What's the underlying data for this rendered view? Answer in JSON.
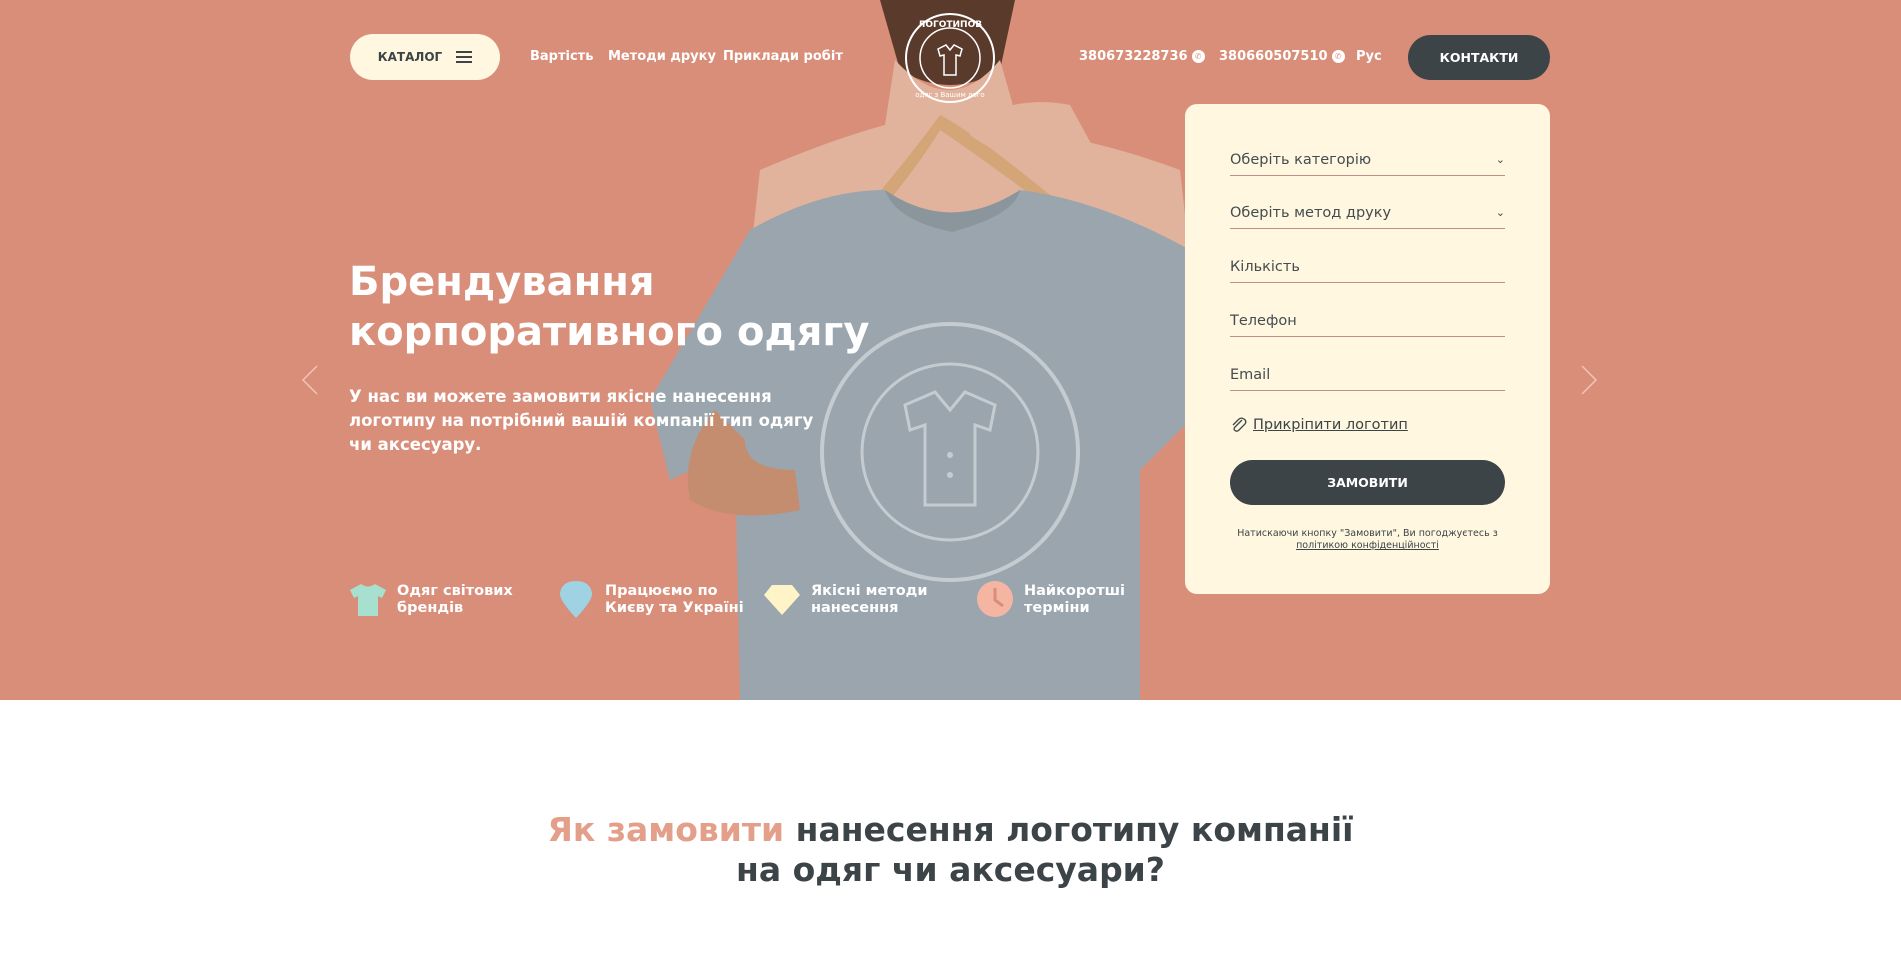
{
  "colors": {
    "hero_bg": "#d98e7a",
    "dark": "#3c4448",
    "cream": "#fff7df",
    "accent": "#e39f89"
  },
  "header": {
    "catalog_label": "КАТАЛОГ",
    "nav": [
      "Вартість",
      "Методи друку",
      "Приклади робіт"
    ],
    "phones": [
      "380673228736",
      "380660507510"
    ],
    "lang": "Рус",
    "contacts_label": "КОНТАКТИ",
    "logo": {
      "top_text": "ЛОГОТИПОВ",
      "bottom_text": "одяг з Вашим лого"
    }
  },
  "hero": {
    "title_line1": "Брендування",
    "title_line2": "корпоративного одягу",
    "subtitle": "У нас ви можете замовити якісне нанесення логотипу на потрібний вашій компанії тип одягу чи аксесуару.",
    "features": [
      {
        "icon": "tshirt-icon",
        "color": "#a8e0cf",
        "line1": "Одяг світових",
        "line2": "брендів"
      },
      {
        "icon": "location-pin-icon",
        "color": "#9fd3e3",
        "line1": "Працюємо по",
        "line2": "Києву та Україні"
      },
      {
        "icon": "diamond-icon",
        "color": "#fff3c8",
        "line1": "Якісні методи",
        "line2": "нанесення"
      },
      {
        "icon": "clock-icon",
        "color": "#f4b6a3",
        "line1": "Найкоротші",
        "line2": "терміни"
      }
    ]
  },
  "form": {
    "category_placeholder": "Оберіть категорію",
    "method_placeholder": "Оберіть метод друку",
    "quantity_placeholder": "Кількість",
    "phone_placeholder": "Телефон",
    "email_placeholder": "Email",
    "attach_label": "Прикріпити логотип",
    "submit_label": "ЗАМОВИТИ",
    "consent_text": "Натискаючи кнопку \"Замовити\", Ви погоджуєтесь з",
    "consent_link": "політикою конфіденційності"
  },
  "section": {
    "title_accent": "Як замовити",
    "title_rest": " нанесення логотипу компанії",
    "title_line2": "на одяг чи аксесуари?"
  }
}
